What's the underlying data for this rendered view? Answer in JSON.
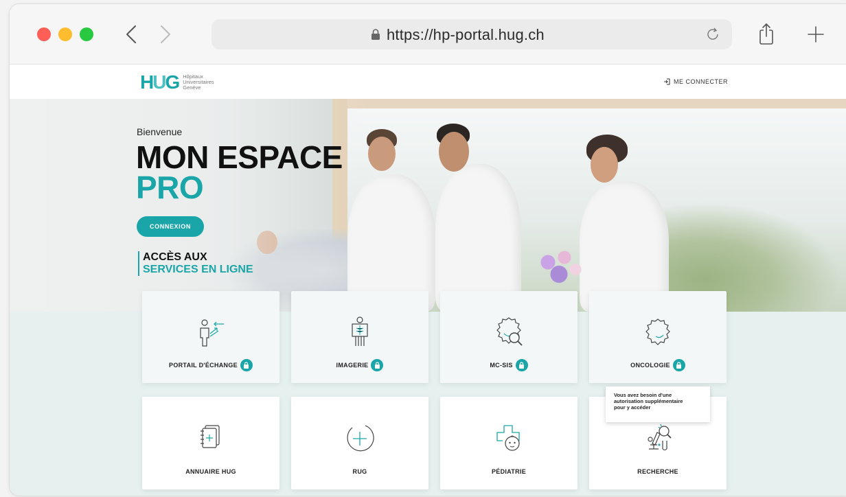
{
  "browser": {
    "url": "https://hp-portal.hug.ch",
    "icons": [
      "back-icon",
      "forward-icon",
      "lock-icon",
      "reload-icon",
      "share-icon",
      "plus-icon"
    ]
  },
  "header": {
    "logo_mark": "HUG",
    "logo_lines": [
      "Hôpitaux",
      "Universitaires",
      "Genève"
    ],
    "login_label": "ME CONNECTER"
  },
  "hero": {
    "greeting": "Bienvenue",
    "title_line1": "MON ESPACE",
    "title_line2": "PRO",
    "button_label": "CONNEXION",
    "access_line1": "ACCÈS AUX",
    "access_line2": "SERVICES EN LIGNE"
  },
  "services": [
    {
      "label": "PORTAIL D'ÉCHANGE",
      "locked": true,
      "icon": "exchange-person-icon"
    },
    {
      "label": "IMAGERIE",
      "locked": true,
      "icon": "xray-icon"
    },
    {
      "label": "MC-SIS",
      "locked": true,
      "icon": "virus-search-icon"
    },
    {
      "label": "ONCOLOGIE",
      "locked": true,
      "icon": "cell-icon"
    },
    {
      "label": "ANNUAIRE HUG",
      "locked": false,
      "icon": "directory-icon"
    },
    {
      "label": "RUG",
      "locked": false,
      "icon": "plus-circle-icon"
    },
    {
      "label": "PÉDIATRIE",
      "locked": false,
      "icon": "baby-cross-icon"
    },
    {
      "label": "RECHERCHE",
      "locked": false,
      "icon": "microscope-icon"
    }
  ],
  "tooltip": {
    "lines": [
      "Vous avez besoin d'une",
      "autorisation supplémentaire",
      "pour y accéder"
    ]
  },
  "colors": {
    "accent": "#1aa6a8",
    "lower_bg": "#e5f0ef"
  }
}
